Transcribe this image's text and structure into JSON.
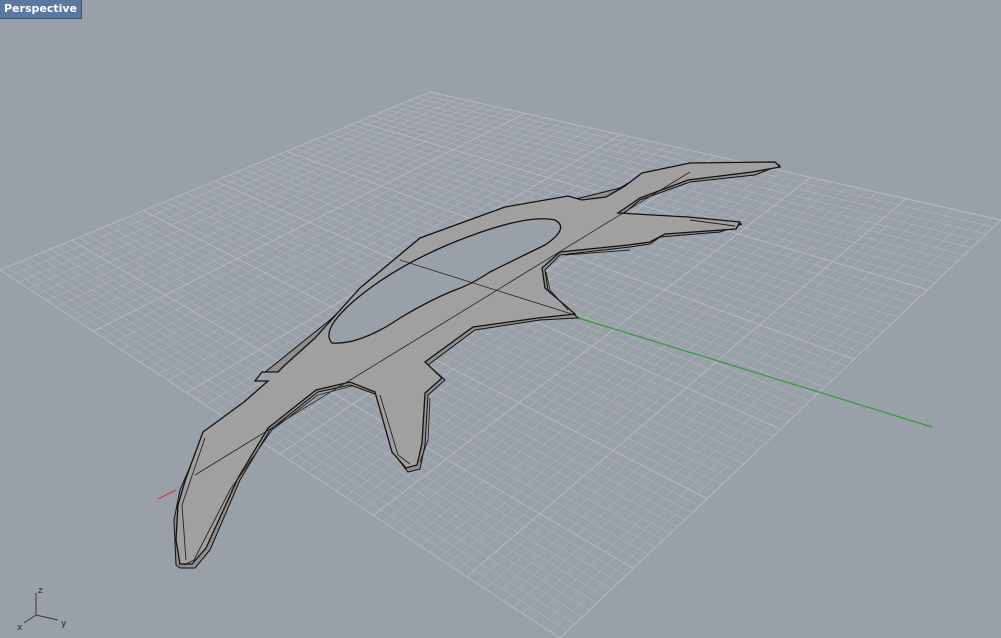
{
  "viewport": {
    "title": "Perspective",
    "background_color": "#9aa0a8",
    "grid_color": "#b8bcc2",
    "x_axis_color": "#c43c3c",
    "y_axis_color": "#2e9e2e",
    "model_fill": "#a0a0a0",
    "model_edge": "#111111"
  },
  "axis_gizmo": {
    "z_label": "z",
    "y_label": "y",
    "x_label": "x"
  }
}
